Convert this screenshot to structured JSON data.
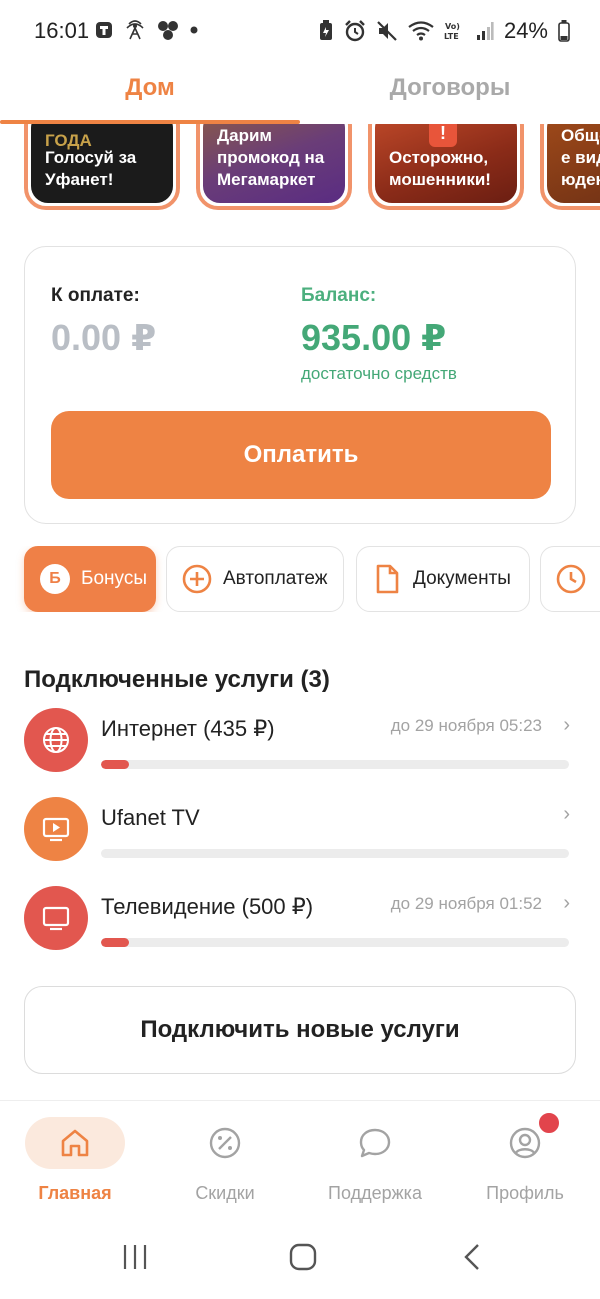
{
  "statusbar": {
    "time": "16:01",
    "battery": "24%"
  },
  "tabs": [
    {
      "label": "Дом"
    },
    {
      "label": "Договоры"
    }
  ],
  "stories": [
    {
      "top": "ГОДА",
      "text": "Голосуй за Уфанет!"
    },
    {
      "text": "Дарим промокод на Мегамаркет"
    },
    {
      "text": "Осторожно, мошенники!"
    },
    {
      "text": "Обще-е вид-юден"
    }
  ],
  "payment": {
    "due_label": "К оплате:",
    "due_amount": "0.00 ₽",
    "balance_label": "Баланс:",
    "balance_amount": "935.00 ₽",
    "balance_note": "достаточно средств",
    "pay_button": "Оплатить"
  },
  "chips": [
    {
      "label": "Бонусы",
      "icon": "bonus-icon",
      "badge_letter": "Б"
    },
    {
      "label": "Автоплатеж",
      "icon": "plus-circle-icon"
    },
    {
      "label": "Документы",
      "icon": "document-icon"
    },
    {
      "label": "",
      "icon": "clock-icon"
    }
  ],
  "services": {
    "title": "Подключенные услуги (3)",
    "items": [
      {
        "name": "Интернет (435 ₽)",
        "date": "до 29 ноября 05:23",
        "icon": "globe-icon",
        "color": "#e2574f",
        "progress": 0.06
      },
      {
        "name": "Ufanet TV",
        "date": "",
        "icon": "play-icon",
        "color": "#ee8344",
        "progress": 0
      },
      {
        "name": "Телевидение (500 ₽)",
        "date": "до 29 ноября 01:52",
        "icon": "tv-icon",
        "color": "#e2574f",
        "progress": 0.06
      }
    ]
  },
  "connect_button": "Подключить новые услуги",
  "bottom_nav": [
    {
      "label": "Главная",
      "icon": "home-icon",
      "active": true
    },
    {
      "label": "Скидки",
      "icon": "discount-icon"
    },
    {
      "label": "Поддержка",
      "icon": "chat-icon"
    },
    {
      "label": "Профиль",
      "icon": "profile-icon",
      "badge": true
    }
  ],
  "colors": {
    "accent": "#ee8344",
    "green": "#44a877",
    "red": "#e2574f"
  }
}
